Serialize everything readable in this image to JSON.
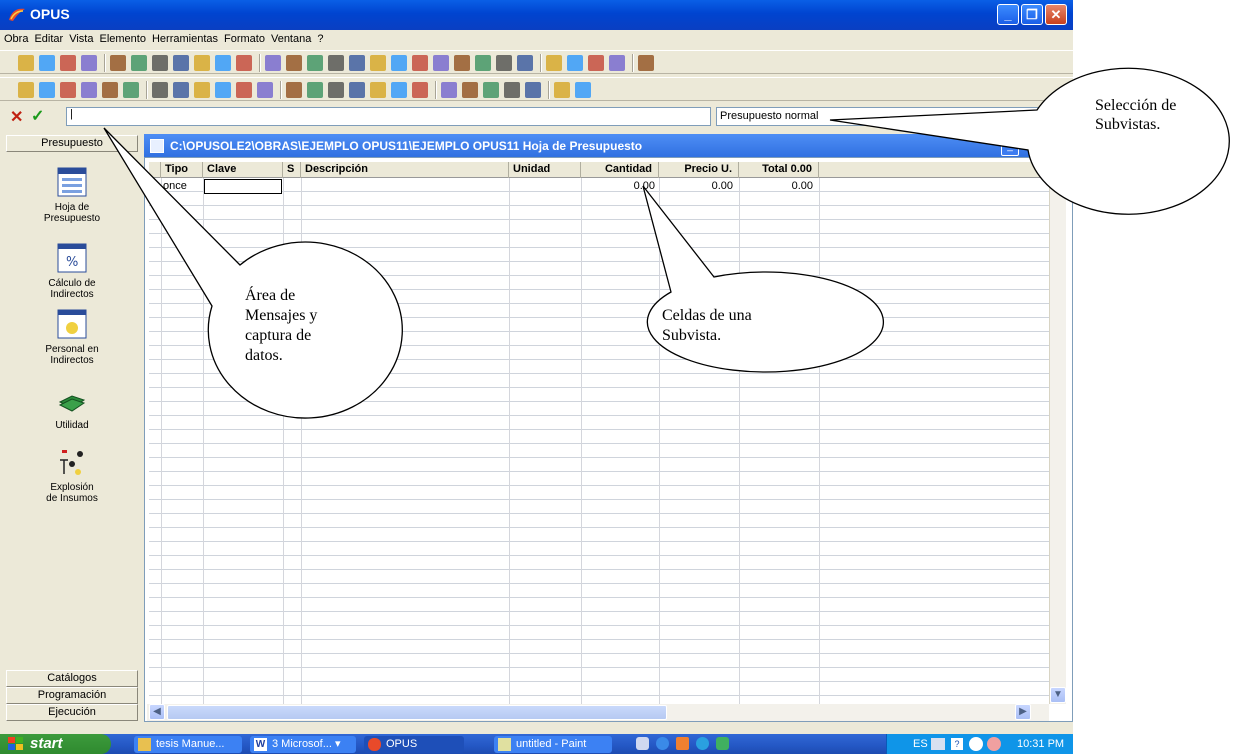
{
  "window": {
    "title": "OPUS"
  },
  "menu": [
    "Obra",
    "Editar",
    "Vista",
    "Elemento",
    "Herramientas",
    "Formato",
    "Ventana",
    "?"
  ],
  "entry_row": {
    "cancel": "✕",
    "accept": "✓",
    "input_value": "|",
    "subview": "Presupuesto normal"
  },
  "left_panel": {
    "top_tab": "Presupuesto",
    "items": [
      {
        "label1": "Hoja de",
        "label2": "Presupuesto",
        "icon": "spreadsheet-icon"
      },
      {
        "label1": "Cálculo de",
        "label2": "Indirectos",
        "icon": "percent-sheet-icon"
      },
      {
        "label1": "Personal en",
        "label2": "Indirectos",
        "icon": "personnel-sheet-icon"
      },
      {
        "label1": "Utilidad",
        "label2": "",
        "icon": "money-icon"
      },
      {
        "label1": "Explosión",
        "label2": "de Insumos",
        "icon": "explosion-icon"
      }
    ],
    "bottom_tabs": [
      "Catálogos",
      "Programación",
      "Ejecución"
    ]
  },
  "document": {
    "title": "C:\\OPUSOLE2\\OBRAS\\EJEMPLO OPUS11\\EJEMPLO OPUS11 Hoja de Presupuesto",
    "columns": [
      "Tipo",
      "Clave",
      "S",
      "Descripción",
      "Unidad",
      "Cantidad",
      "Precio U.",
      "Total 0.00"
    ],
    "row": {
      "tipo": "once",
      "cantidad": "0.00",
      "precio": "0.00",
      "total": "0.00"
    }
  },
  "taskbar": {
    "start": "start",
    "tasks": [
      "tesis Manue...",
      "3 Microsof...",
      "OPUS",
      "untitled - Paint"
    ],
    "lang": "ES",
    "clock": "10:31 PM"
  },
  "callouts": {
    "messages": [
      "Área de",
      "Mensajes y",
      "captura de",
      "datos."
    ],
    "cells": [
      "Celdas de una",
      "Subvista."
    ],
    "subviews": [
      "Selección de",
      "Subvistas."
    ]
  },
  "colors": {
    "title_bar": "#0a4fd8",
    "doc_title": "#3a7de8",
    "taskbar": "#2457c4",
    "start": "#3c9a3c"
  }
}
